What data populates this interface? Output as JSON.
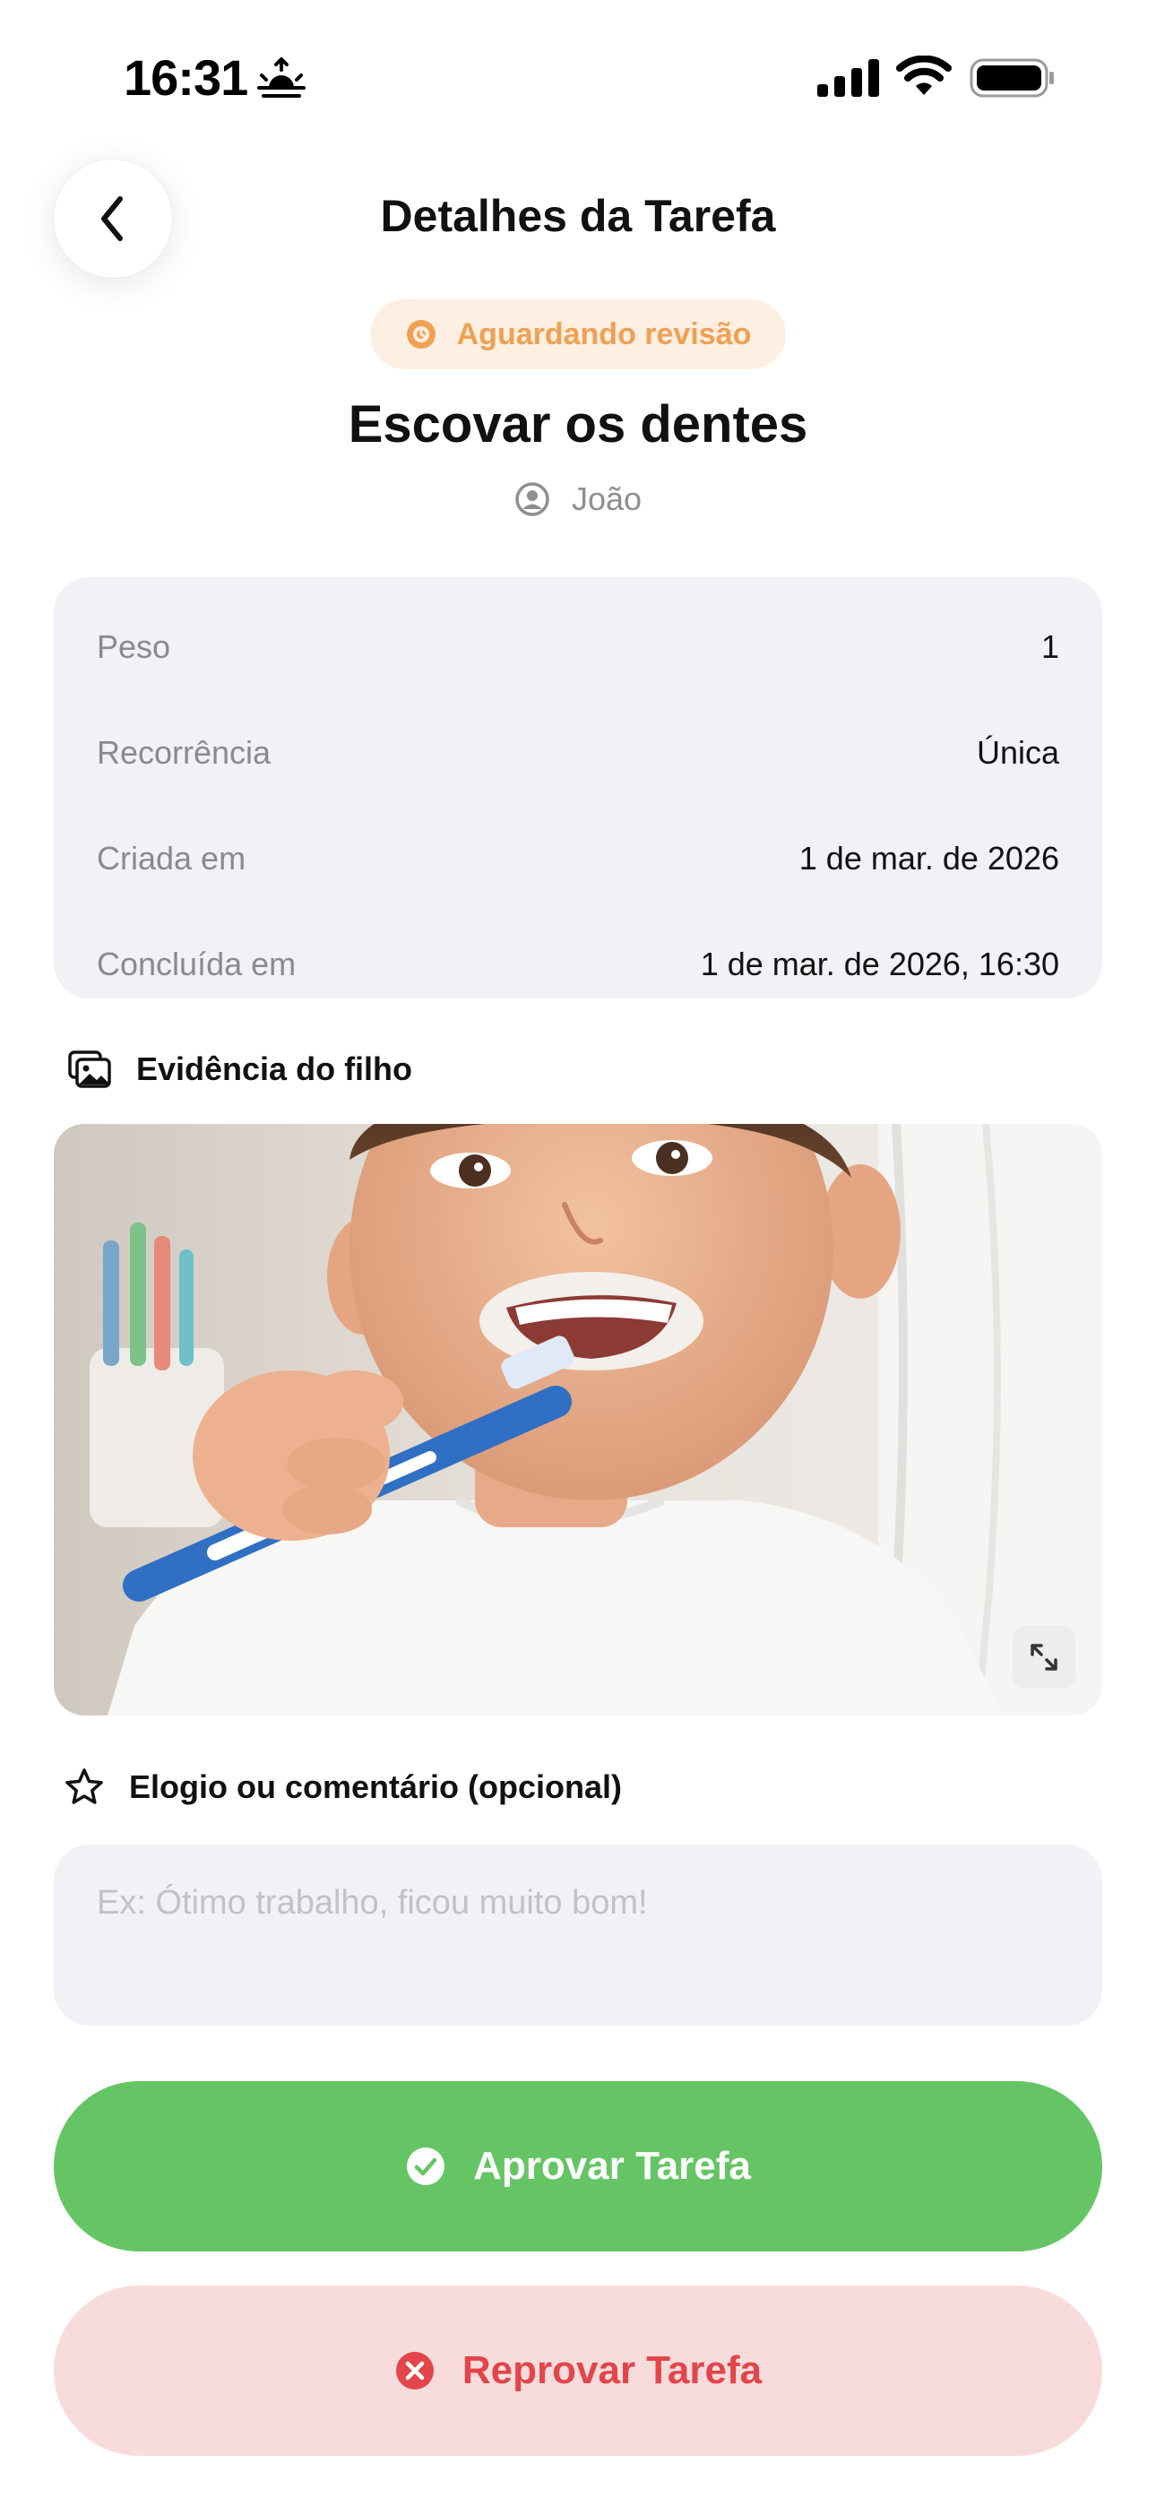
{
  "status_bar": {
    "time": "16:31",
    "icons": [
      "sunrise-icon",
      "signal-icon",
      "wifi-icon",
      "battery-icon"
    ]
  },
  "header": {
    "back_icon": "chevron-left-icon",
    "title": "Detalhes da Tarefa"
  },
  "task": {
    "status": "Aguardando revisão",
    "status_icon": "clock-icon",
    "status_color": "#f0a052",
    "status_bg": "#fdefe2",
    "title": "Escovar os dentes",
    "assignee": "João",
    "assignee_icon": "person-circle-icon"
  },
  "details": [
    {
      "label": "Peso",
      "value": "1"
    },
    {
      "label": "Recorrência",
      "value": "Única"
    },
    {
      "label": "Criada em",
      "value": "1 de mar. de 2026"
    },
    {
      "label": "Concluída em",
      "value": "1 de mar. de 2026, 16:30"
    }
  ],
  "evidence": {
    "title": "Evidência do filho",
    "icon": "photos-icon",
    "expand_icon": "expand-icon"
  },
  "comment": {
    "title": "Elogio ou comentário (opcional)",
    "icon": "star-icon",
    "placeholder": "Ex: Ótimo trabalho, ficou muito bom!",
    "value": ""
  },
  "actions": {
    "approve_label": "Aprovar Tarefa",
    "approve_icon": "checkmark-circle-icon",
    "approve_color": "#65c565",
    "reject_label": "Reprovar Tarefa",
    "reject_icon": "x-circle-icon",
    "reject_color": "#e2454a",
    "reject_bg": "#f8dcdc"
  }
}
